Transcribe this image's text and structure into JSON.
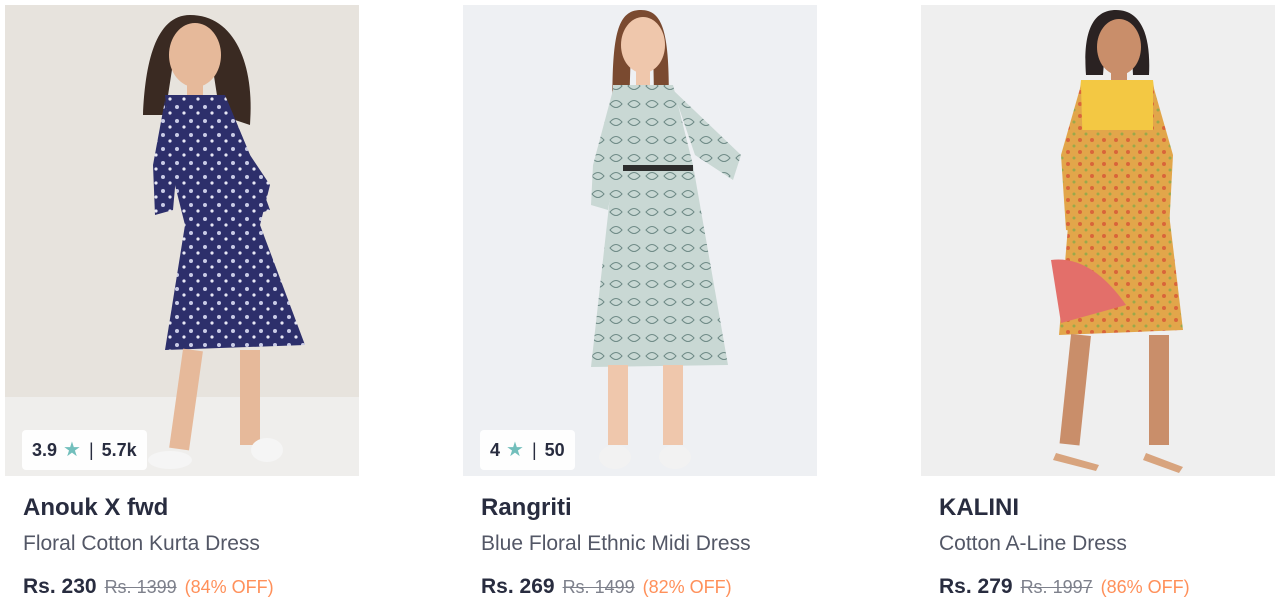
{
  "products": [
    {
      "brand": "Anouk X fwd",
      "title": "Floral Cotton Kurta Dress",
      "price": "Rs. 230",
      "mrp": "Rs. 1399",
      "discount": "(84% OFF)",
      "rating": "3.9",
      "rating_count": "5.7k",
      "image_desc_icon": "dress-photo-icon",
      "dress_color": "#2d2f6b",
      "background_color": "#e7e3dd"
    },
    {
      "brand": "Rangriti",
      "title": "Blue Floral Ethnic Midi Dress",
      "price": "Rs. 269",
      "mrp": "Rs. 1499",
      "discount": "(82% OFF)",
      "rating": "4",
      "rating_count": "50",
      "image_desc_icon": "dress-photo-icon",
      "dress_color": "#c7d6d3",
      "background_color": "#eef0f3"
    },
    {
      "brand": "KALINI",
      "title": "Cotton A-Line Dress",
      "price": "Rs. 279",
      "mrp": "Rs. 1997",
      "discount": "(86% OFF)",
      "image_desc_icon": "dress-photo-icon",
      "dress_color": "#e2a64a",
      "background_color": "#efefef"
    }
  ],
  "colors": {
    "star": "#72bfbc",
    "discount": "#ff905a",
    "text_primary": "#282c3f",
    "text_secondary": "#535766"
  }
}
